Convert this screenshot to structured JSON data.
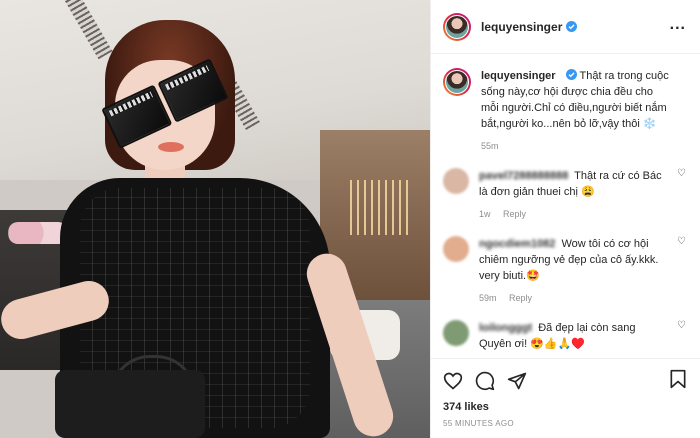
{
  "post": {
    "username": "lequyensinger",
    "options_label": "...",
    "caption_text": "Thật ra trong cuộc sống này,cơ hội được chia đều cho mỗi người.Chỉ có điều,người biết nắm bắt,người ko...nên bỏ lỡ,vậy thôi ❄️",
    "caption_time": "55m",
    "likes": "374 likes",
    "posted_ago": "55 MINUTES AGO"
  },
  "comments": [
    {
      "user": "pavel7288888888",
      "text": "Thật ra cứ có Bác là đơn giản thuei chị 😩",
      "time": "1w",
      "reply": "Reply",
      "avatar_color": "#d9b7a4"
    },
    {
      "user": "ngocdiem1082",
      "text": "Wow tôi có cơ hội chiêm ngưỡng vẻ đẹp của cô ấy.kkk. very biuti.🤩",
      "time": "59m",
      "reply": "Reply",
      "avatar_color": "#e2ad8e"
    },
    {
      "user": "loilongggt",
      "text": "Đã đẹp lại còn sang Quyên ơi! 😍👍🙏♥️",
      "time": "",
      "reply": "",
      "avatar_color": "#7f9b73"
    }
  ],
  "icons": [
    "heart-icon",
    "comment-icon",
    "share-icon",
    "bookmark-icon",
    "verified-badge-icon",
    "more-icon"
  ]
}
